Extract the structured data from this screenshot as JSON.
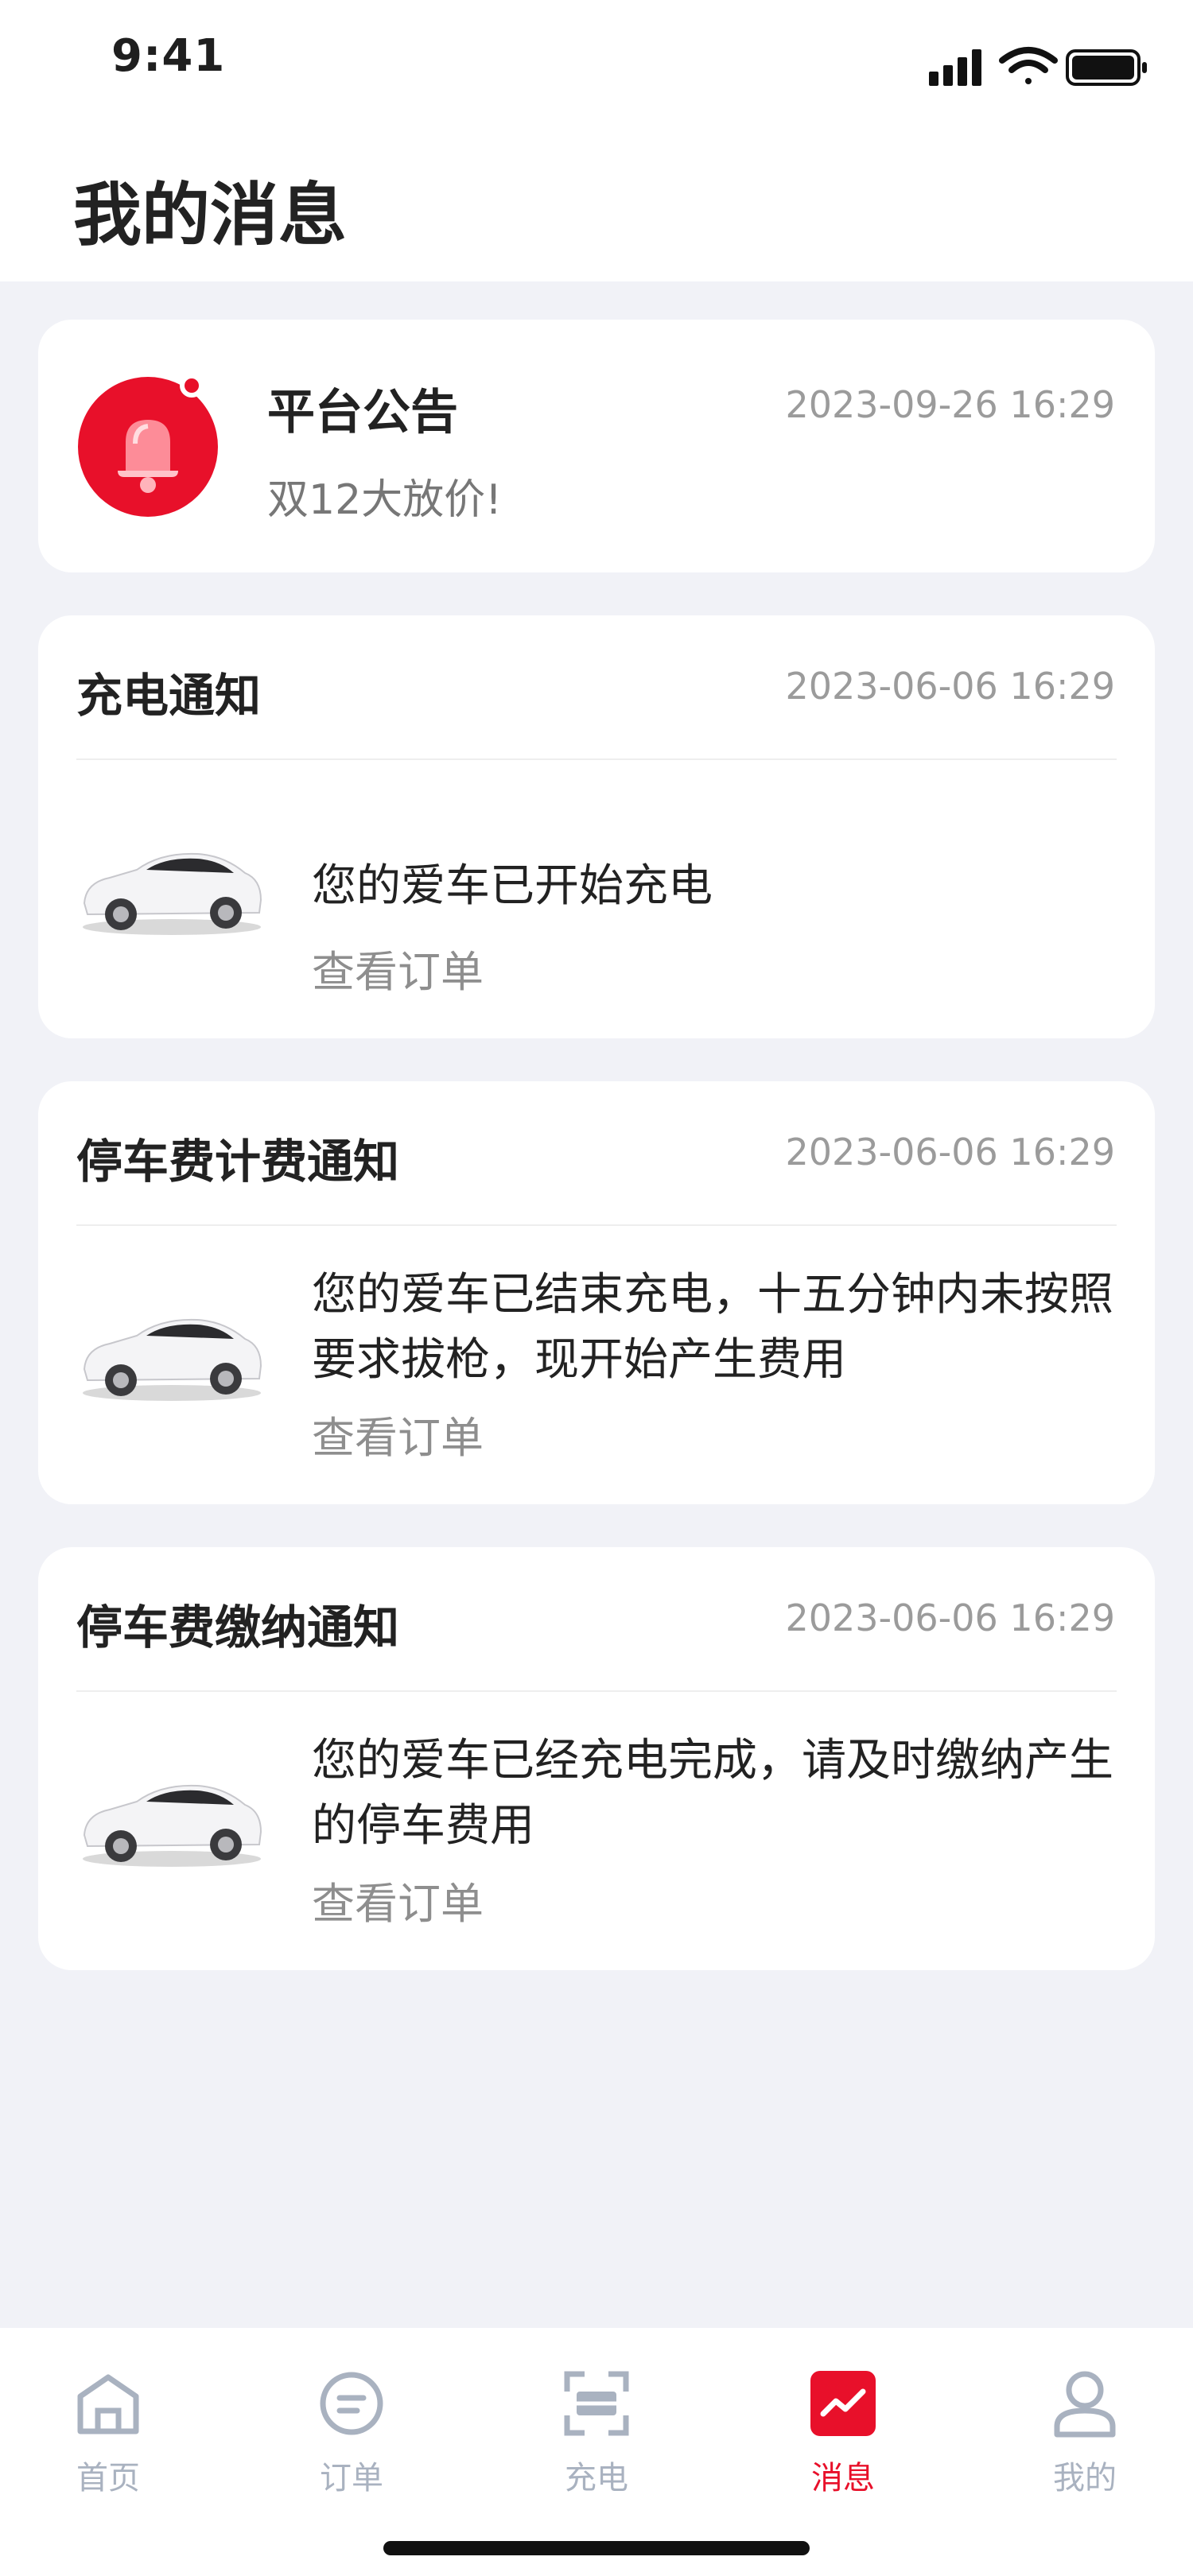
{
  "status": {
    "time": "9:41"
  },
  "header": {
    "title": "我的消息"
  },
  "announcement": {
    "title": "平台公告",
    "time": "2023-09-26 16:29",
    "body": "双12大放价!"
  },
  "notices": [
    {
      "title": "充电通知",
      "time": "2023-06-06 16:29",
      "text": "您的爱车已开始充电",
      "link": "查看订单"
    },
    {
      "title": "停车费计费通知",
      "time": "2023-06-06 16:29",
      "text": "您的爱车已结束充电，十五分钟内未按照要求拔枪，现开始产生费用",
      "link": "查看订单"
    },
    {
      "title": "停车费缴纳通知",
      "time": "2023-06-06 16:29",
      "text": "您的爱车已经充电完成，请及时缴纳产生的停车费用",
      "link": "查看订单"
    }
  ],
  "tabbar": {
    "items": [
      {
        "label": "首页",
        "icon": "home-icon"
      },
      {
        "label": "订单",
        "icon": "order-icon"
      },
      {
        "label": "充电",
        "icon": "charge-scan-icon"
      },
      {
        "label": "消息",
        "icon": "message-icon",
        "active": true
      },
      {
        "label": "我的",
        "icon": "profile-icon"
      }
    ]
  },
  "colors": {
    "accent": "#e8102a",
    "background": "#f1f2f7",
    "muted": "#9b9b9b"
  }
}
